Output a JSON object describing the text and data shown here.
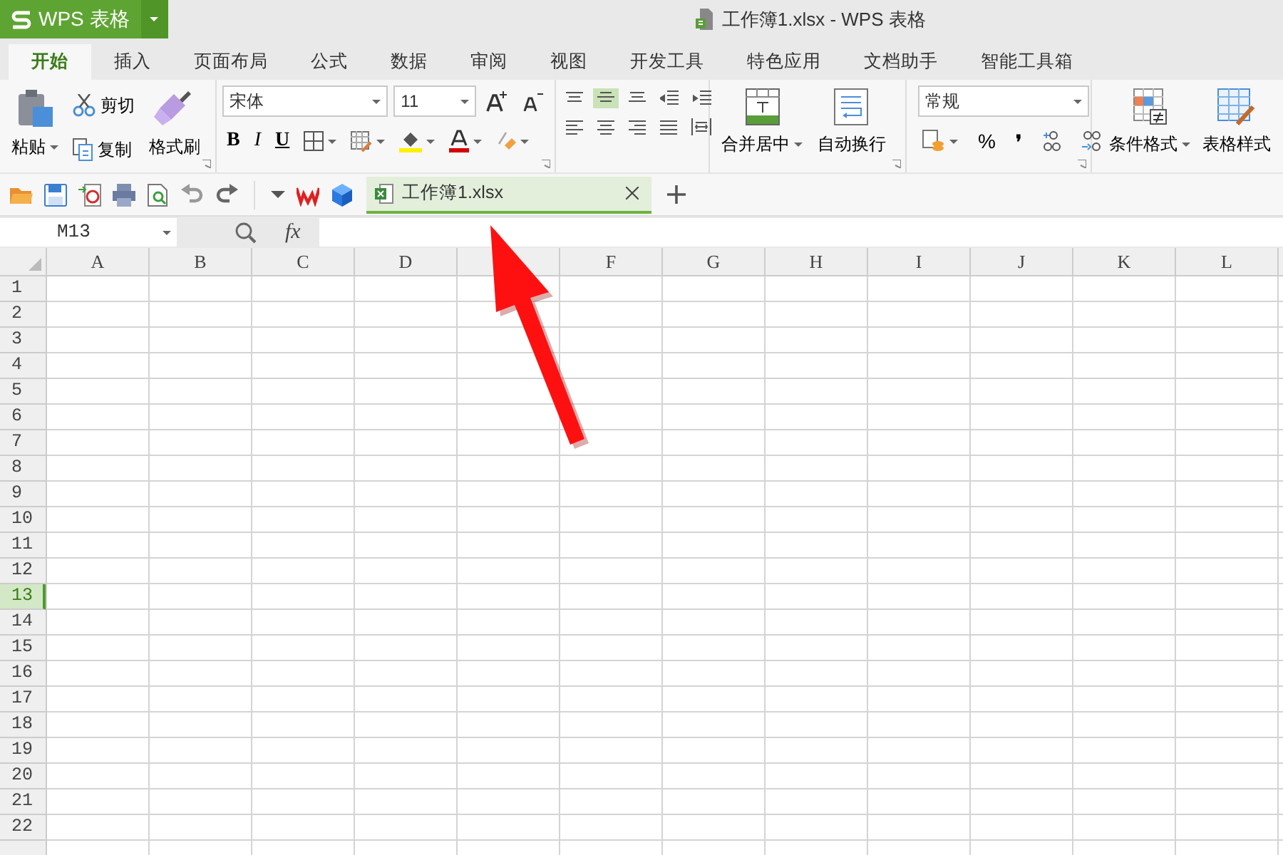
{
  "app_button": {
    "label": "WPS 表格"
  },
  "window": {
    "title": "工作簿1.xlsx - WPS 表格"
  },
  "menu_tabs": [
    {
      "label": "开始",
      "selected": true
    },
    {
      "label": "插入",
      "selected": false
    },
    {
      "label": "页面布局",
      "selected": false
    },
    {
      "label": "公式",
      "selected": false
    },
    {
      "label": "数据",
      "selected": false
    },
    {
      "label": "审阅",
      "selected": false
    },
    {
      "label": "视图",
      "selected": false
    },
    {
      "label": "开发工具",
      "selected": false
    },
    {
      "label": "特色应用",
      "selected": false
    },
    {
      "label": "文档助手",
      "selected": false
    },
    {
      "label": "智能工具箱",
      "selected": false
    }
  ],
  "ribbon": {
    "paste": "粘贴",
    "cut": "剪切",
    "copy": "复制",
    "format_painter": "格式刷",
    "font_name": "宋体",
    "font_size": "11",
    "bold": "B",
    "italic": "I",
    "underline": "U",
    "percent": "%",
    "comma": "❜",
    "merge_center": "合并居中",
    "wrap_text": "自动换行",
    "number_format": "常规",
    "conditional_format": "条件格式",
    "table_style": "表格样式"
  },
  "doc_tabs": [
    {
      "label": "工作簿1.xlsx",
      "selected": true
    }
  ],
  "name_box": "M13",
  "fx_label": "fx",
  "columns": [
    {
      "label": "A"
    },
    {
      "label": "B"
    },
    {
      "label": "C"
    },
    {
      "label": "D"
    },
    {},
    {
      "label": "F"
    },
    {
      "label": "G"
    },
    {
      "label": "H"
    },
    {
      "label": "I"
    },
    {
      "label": "J"
    },
    {
      "label": "K"
    },
    {
      "label": "L"
    }
  ],
  "rows": [
    {
      "label": "1",
      "selected": false
    },
    {
      "label": "2",
      "selected": false
    },
    {
      "label": "3",
      "selected": false
    },
    {
      "label": "4",
      "selected": false
    },
    {
      "label": "5",
      "selected": false
    },
    {
      "label": "6",
      "selected": false
    },
    {
      "label": "7",
      "selected": false
    },
    {
      "label": "8",
      "selected": false
    },
    {
      "label": "9",
      "selected": false
    },
    {
      "label": "10",
      "selected": false
    },
    {
      "label": "11",
      "selected": false
    },
    {
      "label": "12",
      "selected": false
    },
    {
      "label": "13",
      "selected": true
    },
    {
      "label": "14",
      "selected": false
    },
    {
      "label": "15",
      "selected": false
    },
    {
      "label": "16",
      "selected": false
    },
    {
      "label": "17",
      "selected": false
    },
    {
      "label": "18",
      "selected": false
    },
    {
      "label": "19",
      "selected": false
    },
    {
      "label": "20",
      "selected": false
    },
    {
      "label": "21",
      "selected": false
    },
    {
      "label": "22",
      "selected": false
    }
  ],
  "annotation": {
    "kind": "arrow"
  }
}
